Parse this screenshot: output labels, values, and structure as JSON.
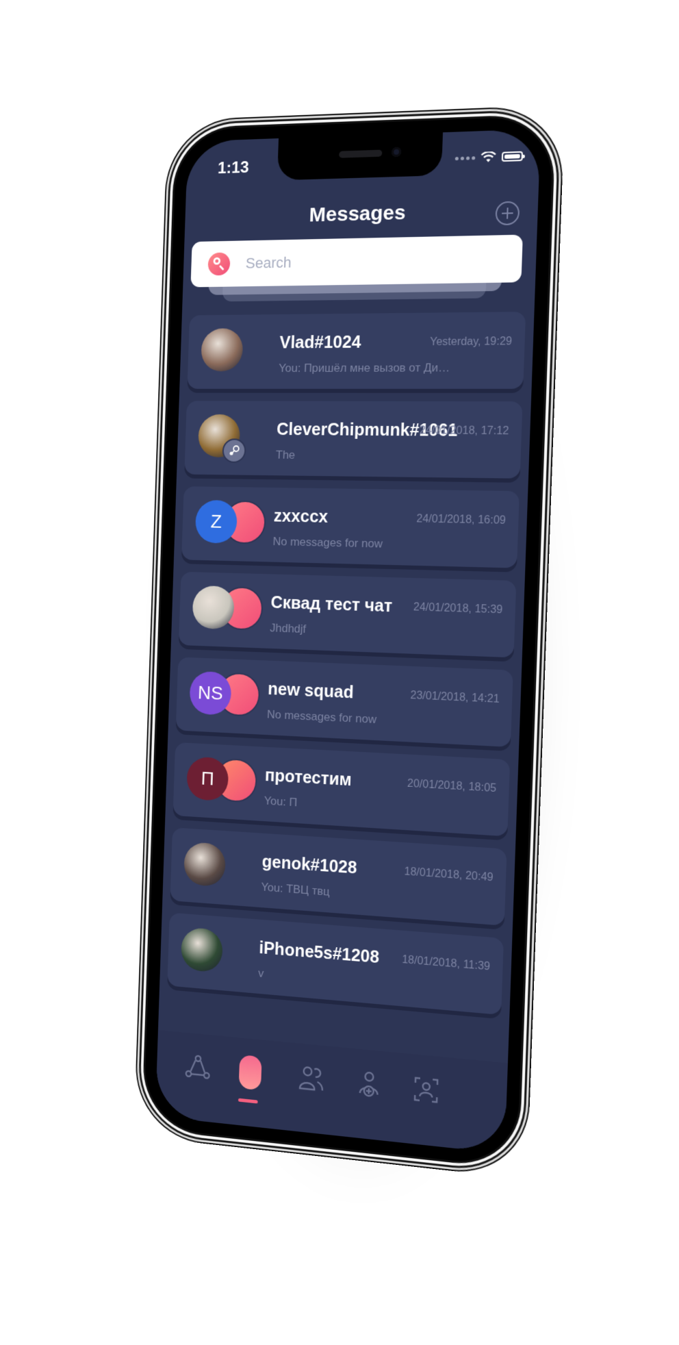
{
  "status_bar": {
    "time": "1:13"
  },
  "header": {
    "title": "Messages"
  },
  "search": {
    "placeholder": "Search"
  },
  "chats": [
    {
      "name": "Vlad#1024",
      "preview": "You: Пришёл мне вызов от Димы и в о...",
      "time": "Yesterday, 19:29",
      "avatar": {
        "type": "photo",
        "color": "#8a6a5a"
      }
    },
    {
      "name": "CleverChipmunk#1061",
      "preview": "The",
      "time": "24/01/2018, 17:12",
      "avatar": {
        "type": "photo",
        "color": "#8f6b34"
      },
      "badge_icon": "steam-icon"
    },
    {
      "name": "zxxccx",
      "preview": "No messages for now",
      "time": "24/01/2018, 16:09",
      "avatar": {
        "type": "initials",
        "initials": "Z",
        "color": "#2f6de0"
      },
      "secondary_color": "#ff7a86"
    },
    {
      "name": "Сквад тест чат",
      "preview": "Jhdhdjf",
      "time": "24/01/2018, 15:39",
      "avatar": {
        "type": "photo",
        "color": "#c9c6bd"
      },
      "secondary_color": "#ff7a86"
    },
    {
      "name": "new squad",
      "preview": "No messages for now",
      "time": "23/01/2018, 14:21",
      "avatar": {
        "type": "initials",
        "initials": "NS",
        "color": "#7b4bd6"
      },
      "secondary_color": "#ff7a86"
    },
    {
      "name": "протестим",
      "preview": "You: П",
      "time": "20/01/2018, 18:05",
      "avatar": {
        "type": "initials",
        "initials": "П",
        "color": "#6d1f33"
      },
      "secondary_color": "#ff8a6a"
    },
    {
      "name": "genok#1028",
      "preview": "You: ТВЦ твц",
      "time": "18/01/2018, 20:49",
      "avatar": {
        "type": "photo",
        "color": "#5a4a45"
      }
    },
    {
      "name": "iPhone5s#1208",
      "preview": "v",
      "time": "18/01/2018, 11:39",
      "avatar": {
        "type": "photo",
        "color": "#2f4a34"
      }
    }
  ],
  "tabs": [
    {
      "icon": "share-icon",
      "active": false
    },
    {
      "icon": "messages-icon",
      "active": true
    },
    {
      "icon": "friends-icon",
      "active": false
    },
    {
      "icon": "add-friend-icon",
      "active": false
    },
    {
      "icon": "profile-icon",
      "active": false
    }
  ],
  "colors": {
    "screen_bg": "#2d3555",
    "card_bg": "#353e61",
    "accent": "#f4607f",
    "muted_text": "#7d84a3"
  }
}
